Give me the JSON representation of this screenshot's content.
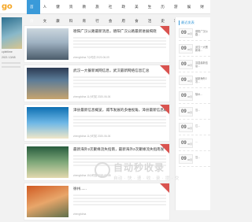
{
  "logo": {
    "text_pre": "",
    "text_go": "go"
  },
  "nav": [
    "首页",
    "人文",
    "健康",
    "资料",
    "教育",
    "旅行",
    "社会",
    "政府",
    "美食",
    "生活",
    "历史",
    "游戏",
    "娱乐",
    "财产"
  ],
  "sidebar_left": {
    "text": "cpleitime",
    "subtext": "2021 13/48"
  },
  "articles": [
    {
      "title": "德阳广汉公路最新消息，德阳广汉公路最新进展揭晓",
      "meta": "zhengfolina  7小时前  2020-06-09",
      "thumb": "linear-gradient(180deg,#cbd6de 0%,#9fb2c2 45%,#4a5b6a 100%)"
    },
    {
      "title": "武汉一大餐新闻网信息，武汉最新网络信息汇总",
      "meta": "zhengfolina  11小时前  2020-06-06",
      "thumb": "linear-gradient(180deg,#2c3a52 0%,#5c7c98 40%,#c7a46e 100%)"
    },
    {
      "title": "漳县最新信息概览，城市发展的多维视角，漳县最新信息概",
      "meta": "zhengfolina  11小时前  2020-06-06",
      "thumb": "linear-gradient(180deg,#0d6fb2 0%,#6db7e6 50%,#f1e7c8 100%)"
    },
    {
      "title": "最新海外2次聚缘流失指南，最新海外2次聚缘流失指南发",
      "meta": "zhengfolina  15小时前  2020-06-05",
      "thumb": "linear-gradient(180deg,#275b3d 0%,#7ea87a 50%,#e2d9ae 100%)"
    },
    {
      "title": "徐州......",
      "meta": "zhengfolina",
      "thumb": "linear-gradient(160deg,#d05b23 0%,#e8a66a 50%,#5e6f4b 100%)"
    }
  ],
  "right_sidebar": {
    "title": "最近发表",
    "items": [
      {
        "day": "09",
        "mon": "06月",
        "text": "德阳广汉公路..."
      },
      {
        "day": "09",
        "mon": "06月",
        "text": "武汉一大餐新闻..."
      },
      {
        "day": "09",
        "mon": "06月",
        "text": "漳县最新信息..."
      },
      {
        "day": "09",
        "mon": "06月",
        "text": "最新海外2次..."
      },
      {
        "day": "09",
        "mon": "06月",
        "text": "徐州..."
      },
      {
        "day": "09",
        "mon": "06月",
        "text": "汉..."
      },
      {
        "day": "09",
        "mon": "06月",
        "text": "江..."
      },
      {
        "day": "09",
        "mon": "06月",
        "text": "..."
      },
      {
        "day": "09",
        "mon": "06月",
        "text": "汉..."
      }
    ]
  },
  "watermark": {
    "main": "自动秒收录",
    "sub": "自动 · 快 · 速 · 收 · 录 · 提 · 交"
  },
  "colors": {
    "accent": "#3a9ad9",
    "badge": "#d9534f"
  }
}
